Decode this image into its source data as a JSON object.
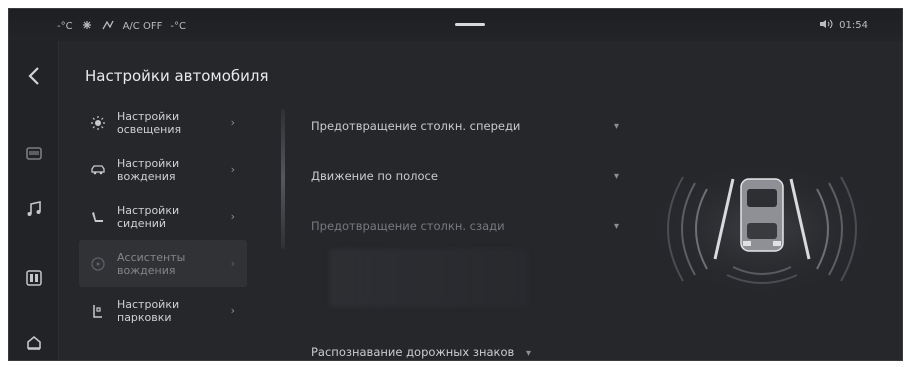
{
  "statusbar": {
    "left_text_1": "-°C",
    "left_text_2": "A/C OFF",
    "left_text_3": "-°C",
    "time": "01:54"
  },
  "header": {
    "title": "Настройки автомобиля"
  },
  "categories": [
    {
      "label": "Настройки освещения",
      "icon": "light-icon"
    },
    {
      "label": "Настройки вождения",
      "icon": "car-icon"
    },
    {
      "label": "Настройки сидений",
      "icon": "seat-icon"
    },
    {
      "label": "Ассистенты вождения",
      "icon": "steering-icon",
      "active": true
    },
    {
      "label": "Настройки парковки",
      "icon": "parking-icon"
    }
  ],
  "settings": {
    "row1": "Предотвращение столкн. спереди",
    "row2": "Движение по полосе",
    "row3": "Предотвращение столкн. сзади",
    "bottom": "Распознавание дорожных знаков"
  },
  "colors": {
    "background": "#26272b",
    "accent": "#d6d7da"
  }
}
